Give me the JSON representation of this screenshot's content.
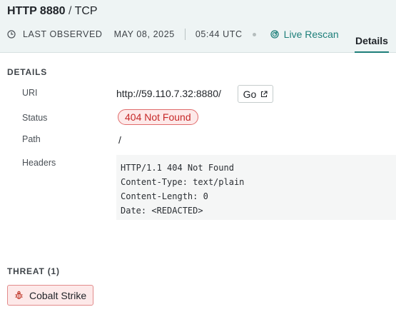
{
  "header": {
    "protocol_port": "HTTP 8880",
    "separator": " / ",
    "transport": "TCP",
    "last_observed_label": "LAST OBSERVED",
    "date": "MAY 08, 2025",
    "time": "05:44 UTC",
    "rescan_label": "Live Rescan",
    "tab_label": "Details"
  },
  "details": {
    "section_title": "DETAILS",
    "uri_label": "URI",
    "uri_value": "http://59.110.7.32:8880/",
    "go_label": "Go",
    "status_label": "Status",
    "status_value": "404 Not Found",
    "path_label": "Path",
    "path_value": "/",
    "headers_label": "Headers",
    "headers_lines": [
      "HTTP/1.1 404 Not Found",
      "Content-Type: text/plain",
      "Content-Length: 0",
      "Date: <REDACTED>"
    ]
  },
  "threat": {
    "section_title": "THREAT (1)",
    "items": [
      "Cobalt Strike"
    ]
  },
  "colors": {
    "accent": "#1e7f7a",
    "header_bg": "#eef4f4",
    "error_text": "#c62828",
    "error_bg": "#fde9e9"
  },
  "icons": {
    "clock": "clock-icon",
    "rescan": "rescan-icon",
    "external": "external-link-icon",
    "threat": "bug-icon"
  }
}
